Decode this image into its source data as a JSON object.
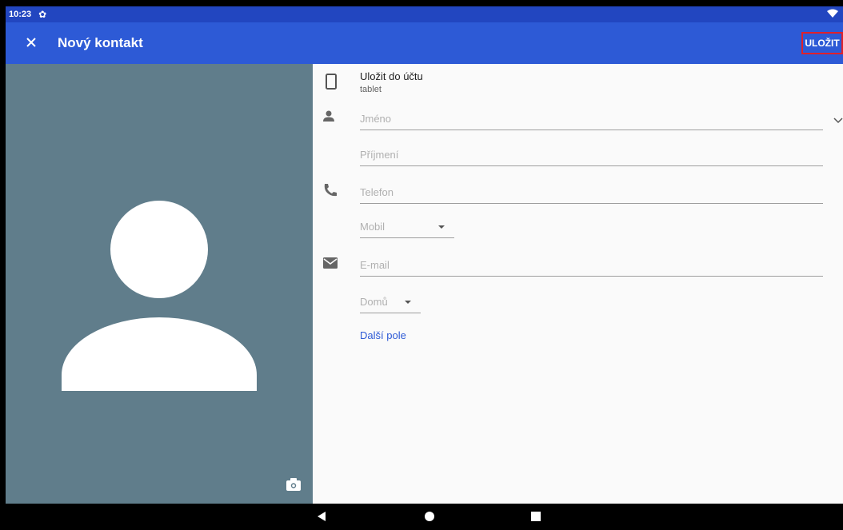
{
  "status_bar": {
    "time": "10:23"
  },
  "app_bar": {
    "title": "Nový kontakt",
    "save_label": "ULOŽIT"
  },
  "account": {
    "label": "Uložit do účtu",
    "value": "tablet"
  },
  "fields": {
    "first_name_placeholder": "Jméno",
    "last_name_placeholder": "Příjmení",
    "phone_placeholder": "Telefon",
    "phone_type": "Mobil",
    "email_placeholder": "E-mail",
    "email_type": "Domů"
  },
  "more_fields_label": "Další pole",
  "colors": {
    "status_bar": "#2246c0",
    "app_bar": "#2d5ad6",
    "photo_background": "#607d8b",
    "form_background": "#fafafa",
    "highlight": "#e0202a"
  },
  "icons": [
    "close-icon",
    "settings-icon",
    "wifi-icon",
    "tablet-icon",
    "person-icon",
    "chevron-down-icon",
    "phone-icon",
    "email-icon",
    "camera-icon",
    "back-icon",
    "home-icon",
    "recents-icon"
  ]
}
